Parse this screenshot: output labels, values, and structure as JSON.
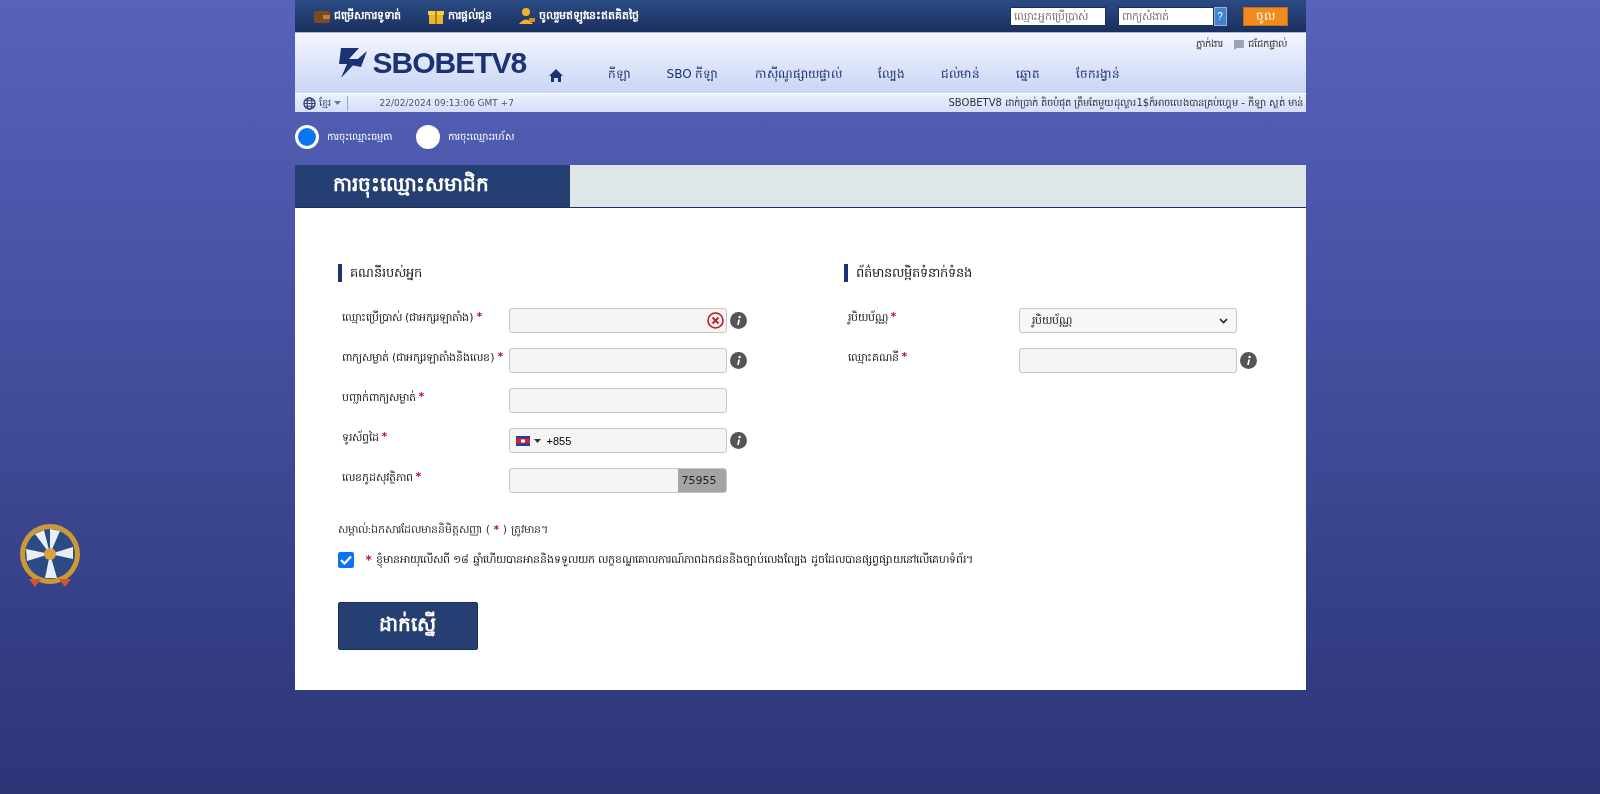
{
  "top_bar": {
    "links": [
      {
        "kind": "wallet",
        "label": "ជម្រើសការទូទាត់"
      },
      {
        "kind": "gift",
        "label": "ការផ្តល់ជូន"
      },
      {
        "kind": "person",
        "label": "ចូលរួមឥឡូវនេះឥតគិតថ្លៃ"
      }
    ],
    "login": {
      "username_placeholder": "ឈ្មោះអ្នកប្រើប្រាស់",
      "password_placeholder": "ពាក្យសំងាត់",
      "help": "?",
      "button": "ចូល"
    }
  },
  "header": {
    "logo": "SBOBETV8",
    "agent": "ភ្នាក់ងារ",
    "chat": "ជជែកផ្ទាល់",
    "nav": [
      {
        "kind": "home"
      },
      {
        "kind": "text",
        "label": "កីឡា"
      },
      {
        "kind": "text",
        "label": "SBO កីឡា"
      },
      {
        "kind": "text",
        "label": "កាស៊ីណូផ្សាយផ្ទាល់"
      },
      {
        "kind": "text",
        "label": "ល្បែង"
      },
      {
        "kind": "text",
        "label": "ជល់មាន់"
      },
      {
        "kind": "text",
        "label": "ឆ្នោត"
      },
      {
        "kind": "text",
        "label": "ចែករង្វាន់"
      }
    ]
  },
  "info_bar": {
    "language": "ខ្មែរ",
    "datetime": "22/02/2024 09:13:06 GMT +7",
    "ticker": "SBOBETV8 ដាក់ប្រាក់ តិចបំផុត ត្រឹមតែមួយដុល្លារ1$ក៏អាចលេងបានគ្រប់ហ្គេម - កីឡា ស្លត់ មាន់"
  },
  "registration_types": [
    {
      "label": "ការចុះឈ្មោះធម្មតា",
      "selected": true
    },
    {
      "label": "ការចុះឈ្មោះរហ័ស",
      "selected": false
    }
  ],
  "title": "ការចុះឈ្មោះសមាជិក",
  "account": {
    "heading": "គណនីរបស់អ្នក",
    "fields": [
      {
        "kind": "text",
        "label": "ឈ្មោះប្រើប្រាស់ (ជាអក្សរឡាតាំង)",
        "required": "*",
        "invalid": true,
        "info": true
      },
      {
        "kind": "text",
        "label": "ពាក្យសម្ងាត់ (ជាអក្សរឡាតាំងនិងលេខ)",
        "required": "*",
        "invalid": false,
        "info": true
      },
      {
        "kind": "text",
        "label": "បញ្ជាក់ពាក្យសម្ងាត់",
        "required": "*",
        "invalid": false,
        "info": false
      },
      {
        "kind": "phone",
        "label": "ទូរស័ព្ទដៃ",
        "required": "*",
        "value": "+855",
        "info": true
      },
      {
        "kind": "captcha",
        "label": "លេខកូដសុវត្ថិភាព",
        "required": "*",
        "code": "75955",
        "info": false
      }
    ]
  },
  "contact": {
    "heading": "ព័ត៌មានលម្អិតទំនាក់ទំនង",
    "fields": [
      {
        "kind": "select",
        "label": "រូបិយប័ណ្ណ",
        "required": "*",
        "value": "រូបិយប័ណ្ណ",
        "info": false
      },
      {
        "kind": "text",
        "label": "ឈ្មោះគណនី",
        "required": "*",
        "invalid": false,
        "info": true
      }
    ]
  },
  "note": {
    "before": "សម្គាល់:ឯកសារដែលមាននិមិត្តសញ្ញា (",
    "mark": "*",
    "after": ") ត្រូវមាន។"
  },
  "agreement": {
    "mark": "*",
    "text": "ខ្ញុំមានអាយុលើសពី ១៨ ឆ្នាំហើយបានអាននិងទទួលយក លក្ខខណ្ឌគោលការណ៍ភាពឯកជននិងច្បាប់លេងល្បែង ដូចដែលបានផ្សព្វផ្សាយនៅលើគេហទំព័រ។",
    "checked": true
  },
  "submit": "ដាក់ស្នើ"
}
